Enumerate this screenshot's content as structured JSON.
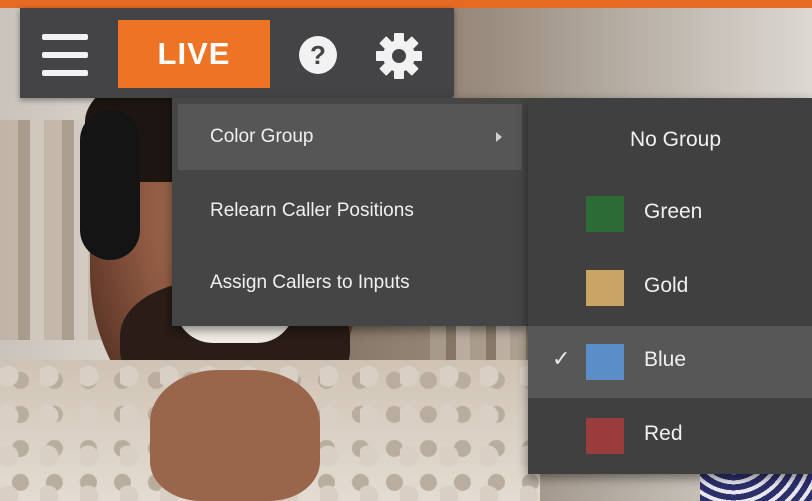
{
  "toolbar": {
    "live_label": "LIVE",
    "accent_color": "#ee7425"
  },
  "menu": {
    "items": [
      {
        "label": "Color Group",
        "has_submenu": true,
        "active": true
      },
      {
        "label": "Relearn Caller Positions",
        "has_submenu": false,
        "active": false
      },
      {
        "label": "Assign Callers to Inputs",
        "has_submenu": false,
        "active": false
      }
    ]
  },
  "submenu": {
    "items": [
      {
        "label": "No Group",
        "color": null,
        "checked": false
      },
      {
        "label": "Green",
        "color": "#2b6b35",
        "checked": false
      },
      {
        "label": "Gold",
        "color": "#c9a464",
        "checked": false
      },
      {
        "label": "Blue",
        "color": "#5b8ec8",
        "checked": true
      },
      {
        "label": "Red",
        "color": "#9a3c3c",
        "checked": false
      }
    ],
    "check_glyph": "✓"
  },
  "icons": {
    "menu": "hamburger-menu-icon",
    "help": "help-icon",
    "settings": "gear-icon",
    "submenu_arrow": "chevron-right-icon"
  }
}
